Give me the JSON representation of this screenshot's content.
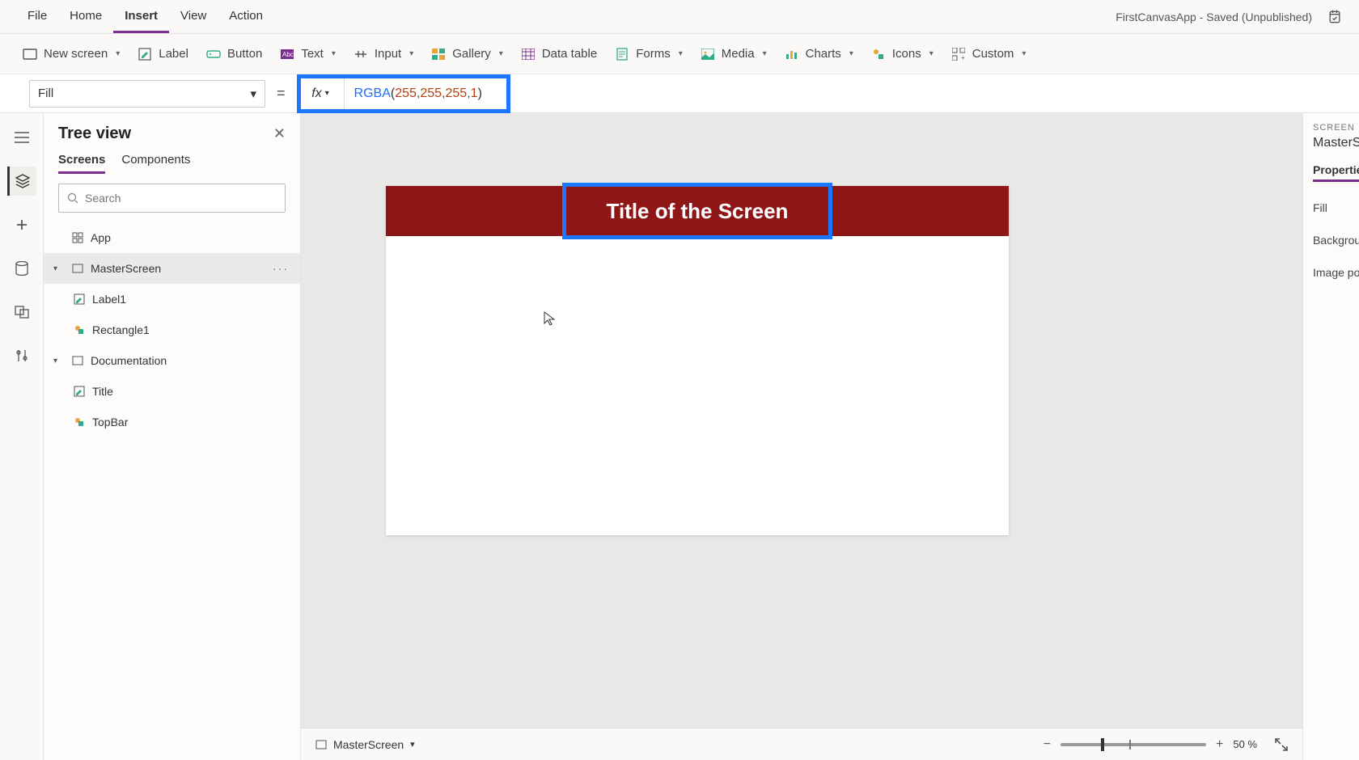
{
  "menubar": {
    "items": [
      "File",
      "Home",
      "Insert",
      "View",
      "Action"
    ],
    "active_index": 2,
    "title_right": "FirstCanvasApp - Saved (Unpublished)"
  },
  "ribbon": {
    "new_screen": "New screen",
    "label": "Label",
    "button": "Button",
    "text": "Text",
    "input": "Input",
    "gallery": "Gallery",
    "data_table": "Data table",
    "forms": "Forms",
    "media": "Media",
    "charts": "Charts",
    "icons": "Icons",
    "custom": "Custom"
  },
  "formula": {
    "property": "Fill",
    "fx": "fx",
    "fn": "RGBA",
    "args": [
      "255",
      "255",
      "255",
      "1"
    ]
  },
  "tree": {
    "title": "Tree view",
    "tabs": [
      "Screens",
      "Components"
    ],
    "active_tab": 0,
    "search_placeholder": "Search",
    "items": [
      {
        "label": "App",
        "type": "app"
      },
      {
        "label": "MasterScreen",
        "type": "screen",
        "selected": true,
        "expand": true
      },
      {
        "label": "Label1",
        "type": "label",
        "indent": true
      },
      {
        "label": "Rectangle1",
        "type": "rect",
        "indent": true
      },
      {
        "label": "Documentation",
        "type": "screen",
        "expand": true
      },
      {
        "label": "Title",
        "type": "label",
        "indent": true
      },
      {
        "label": "TopBar",
        "type": "rect",
        "indent": true
      }
    ]
  },
  "canvas": {
    "title_text": "Title of the Screen",
    "footer_screen": "MasterScreen",
    "zoom_pct": "50",
    "zoom_unit": "%"
  },
  "props": {
    "heading": "SCREEN",
    "object": "MasterScreen",
    "tab": "Properties",
    "rows": [
      "Fill",
      "Background",
      "Image position"
    ]
  }
}
